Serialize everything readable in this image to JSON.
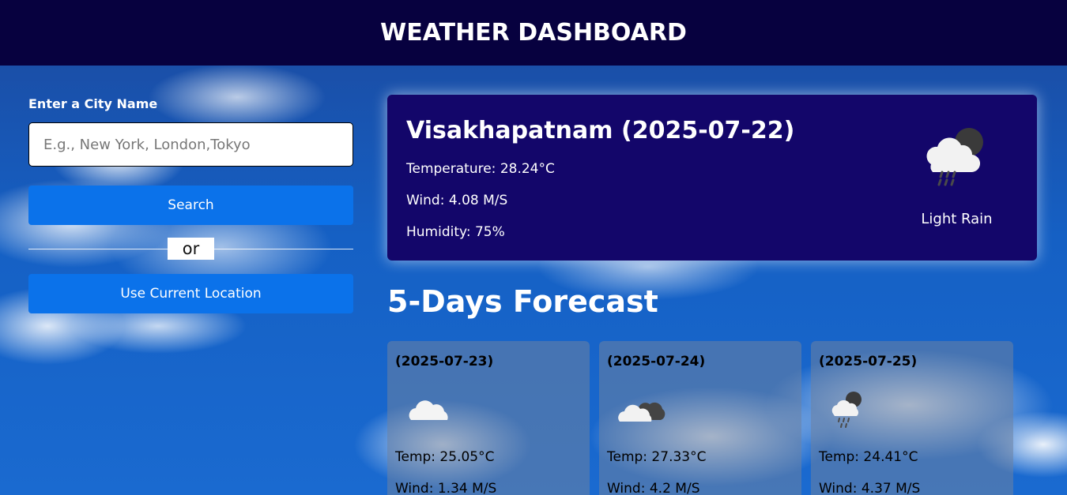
{
  "header": {
    "title": "WEATHER DASHBOARD"
  },
  "search": {
    "label": "Enter a City Name",
    "placeholder": "E.g., New York, London,Tokyo",
    "value": "",
    "search_button": "Search",
    "divider_text": "or",
    "location_button": "Use Current Location"
  },
  "current": {
    "title": "Visakhapatnam (2025-07-22)",
    "temperature": "Temperature: 28.24°C",
    "wind": "Wind: 4.08 M/S",
    "humidity": "Humidity: 75%",
    "condition": "Light Rain",
    "icon": "light-rain-night-icon"
  },
  "forecast": {
    "title": "5-Days Forecast",
    "days": [
      {
        "date": "(2025-07-23)",
        "temp": "Temp: 25.05°C",
        "wind": "Wind: 1.34 M/S",
        "icon": "cloud-icon"
      },
      {
        "date": "(2025-07-24)",
        "temp": "Temp: 27.33°C",
        "wind": "Wind: 4.2 M/S",
        "icon": "broken-clouds-icon"
      },
      {
        "date": "(2025-07-25)",
        "temp": "Temp: 24.41°C",
        "wind": "Wind: 4.37 M/S",
        "icon": "light-rain-icon"
      }
    ]
  },
  "colors": {
    "header_bg": "#07013f",
    "current_card_bg": "#13066a",
    "button_bg": "#0b72ea"
  }
}
